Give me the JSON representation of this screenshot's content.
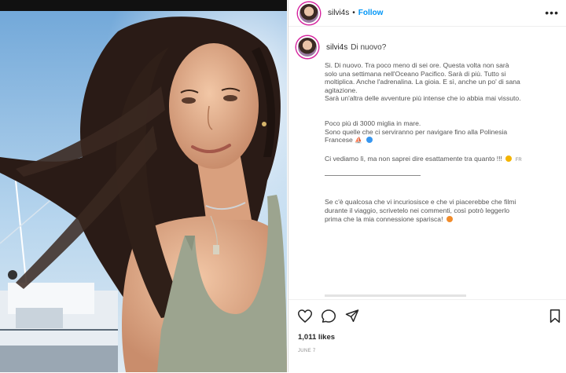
{
  "post": {
    "username": "silvi4s",
    "separator": "•",
    "follow_label": "Follow",
    "more_label": "•••",
    "caption_first_line": "Di nuovo?",
    "caption_lines": [
      "Si. Di nuovo. Tra poco meno di sei ore. Questa volta non sarà",
      "solo una settimana nell'Oceano Pacifico. Sarà di più. Tutto si",
      "moltiplica. Anche l'adrenalina. La gioia. E sì, anche un po' di sana",
      "agitazione.",
      "Sarà un'altra delle avventure più intense che io abbia mai vissuto."
    ],
    "caption_lines_2": [
      "Poco più di 3000 miglia in mare.",
      "Sono quelle che ci serviranno per navigare fino alla Polinesia",
      "Francese"
    ],
    "caption_line_3": "Ci vediamo lì, ma non saprei dire esattamente tra quanto !!!",
    "fr_label": "FR",
    "caption_lines_4": [
      "Se c'è qualcosa che vi incuriosisce e che vi piacerebbe che filmi",
      "durante il viaggio, scrivetelo nei commenti, così potrò leggerlo",
      "prima che la mia connessione sparisca!"
    ],
    "likes": "1,011 likes",
    "date": "JUNE 7"
  },
  "icons": {
    "like": "heart-icon",
    "comment": "comment-icon",
    "share": "paper-plane-icon",
    "save": "bookmark-icon"
  },
  "colors": {
    "follow": "#0095f6",
    "text": "#262626",
    "muted": "#8e8e8e",
    "sky": "#9cc3e6",
    "avatar_ring": "#d6249f"
  }
}
